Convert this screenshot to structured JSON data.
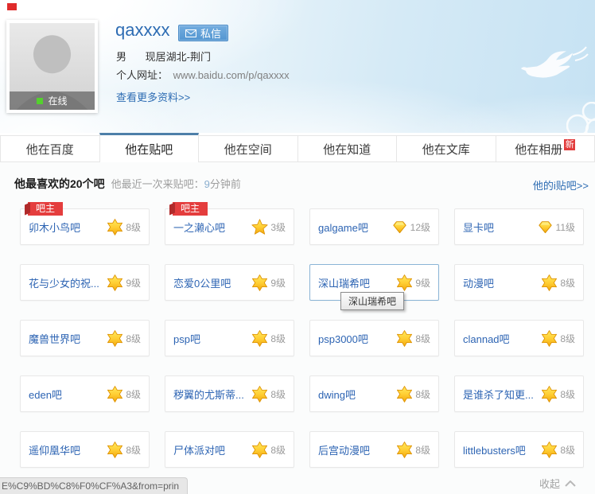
{
  "profile": {
    "username": "qaxxxx",
    "message_button": "私信",
    "online_status": "在线",
    "gender": "男",
    "location": "现居湖北-荆门",
    "website_label": "个人网址：",
    "website_url": "www.baidu.com/p/qaxxxx",
    "more_link": "查看更多资料>>"
  },
  "tabs": [
    {
      "key": "baidu",
      "label": "他在百度",
      "active": false
    },
    {
      "key": "tieba",
      "label": "他在贴吧",
      "active": true
    },
    {
      "key": "kongjian",
      "label": "他在空间",
      "active": false
    },
    {
      "key": "zhidao",
      "label": "他在知道",
      "active": false
    },
    {
      "key": "wenku",
      "label": "他在文库",
      "active": false
    },
    {
      "key": "xiangce",
      "label": "他在相册",
      "active": false,
      "badge": "新"
    }
  ],
  "section": {
    "title": "他最喜欢的20个吧",
    "subtitle": "他最近一次来贴吧：",
    "time_number": "9",
    "time_suffix": "分钟前",
    "right_link": "他的i贴吧>>"
  },
  "owner_badge": "吧主",
  "forums": [
    {
      "name": "卯木小鸟吧",
      "level": "8级",
      "icon": "star6",
      "owner": true
    },
    {
      "name": "一之濑心吧",
      "level": "3级",
      "icon": "star5",
      "owner": true
    },
    {
      "name": "galgame吧",
      "level": "12级",
      "icon": "diamond"
    },
    {
      "name": "显卡吧",
      "level": "11级",
      "icon": "diamond"
    },
    {
      "name": "花与少女的祝...",
      "level": "9级",
      "icon": "star6"
    },
    {
      "name": "恋爱0公里吧",
      "level": "9级",
      "icon": "star6"
    },
    {
      "name": "深山瑞希吧",
      "level": "9级",
      "icon": "star6",
      "highlighted": true,
      "tooltip": "深山瑞希吧"
    },
    {
      "name": "动漫吧",
      "level": "8级",
      "icon": "star6"
    },
    {
      "name": "魔兽世界吧",
      "level": "8级",
      "icon": "star6"
    },
    {
      "name": "psp吧",
      "level": "8级",
      "icon": "star6"
    },
    {
      "name": "psp3000吧",
      "level": "8级",
      "icon": "star6"
    },
    {
      "name": "clannad吧",
      "level": "8级",
      "icon": "star6"
    },
    {
      "name": "eden吧",
      "level": "8级",
      "icon": "star6"
    },
    {
      "name": "秽翼的尤斯蒂...",
      "level": "8级",
      "icon": "star6"
    },
    {
      "name": "dwing吧",
      "level": "8级",
      "icon": "star6"
    },
    {
      "name": "是谁杀了知更...",
      "level": "8级",
      "icon": "star6"
    },
    {
      "name": "遥仰凰华吧",
      "level": "8级",
      "icon": "star6"
    },
    {
      "name": "尸体派对吧",
      "level": "8级",
      "icon": "star6"
    },
    {
      "name": "后宫动漫吧",
      "level": "8级",
      "icon": "star6"
    },
    {
      "name": "littlebusters吧",
      "level": "8级",
      "icon": "star6"
    }
  ],
  "footer": {
    "status_url": "E%C9%BD%C8%F0%CF%A3&from=prin",
    "collapse": "收起"
  },
  "colors": {
    "link_blue": "#2d64b3",
    "tab_active_border": "#4d7fa9",
    "ribbon_red": "#e43d3d",
    "new_badge_red": "#e23c3c",
    "level_text_gray": "#9a9a9a",
    "online_green": "#54d02e",
    "star_gold": "#ffcf35",
    "message_button_blue": "#5396d1"
  }
}
